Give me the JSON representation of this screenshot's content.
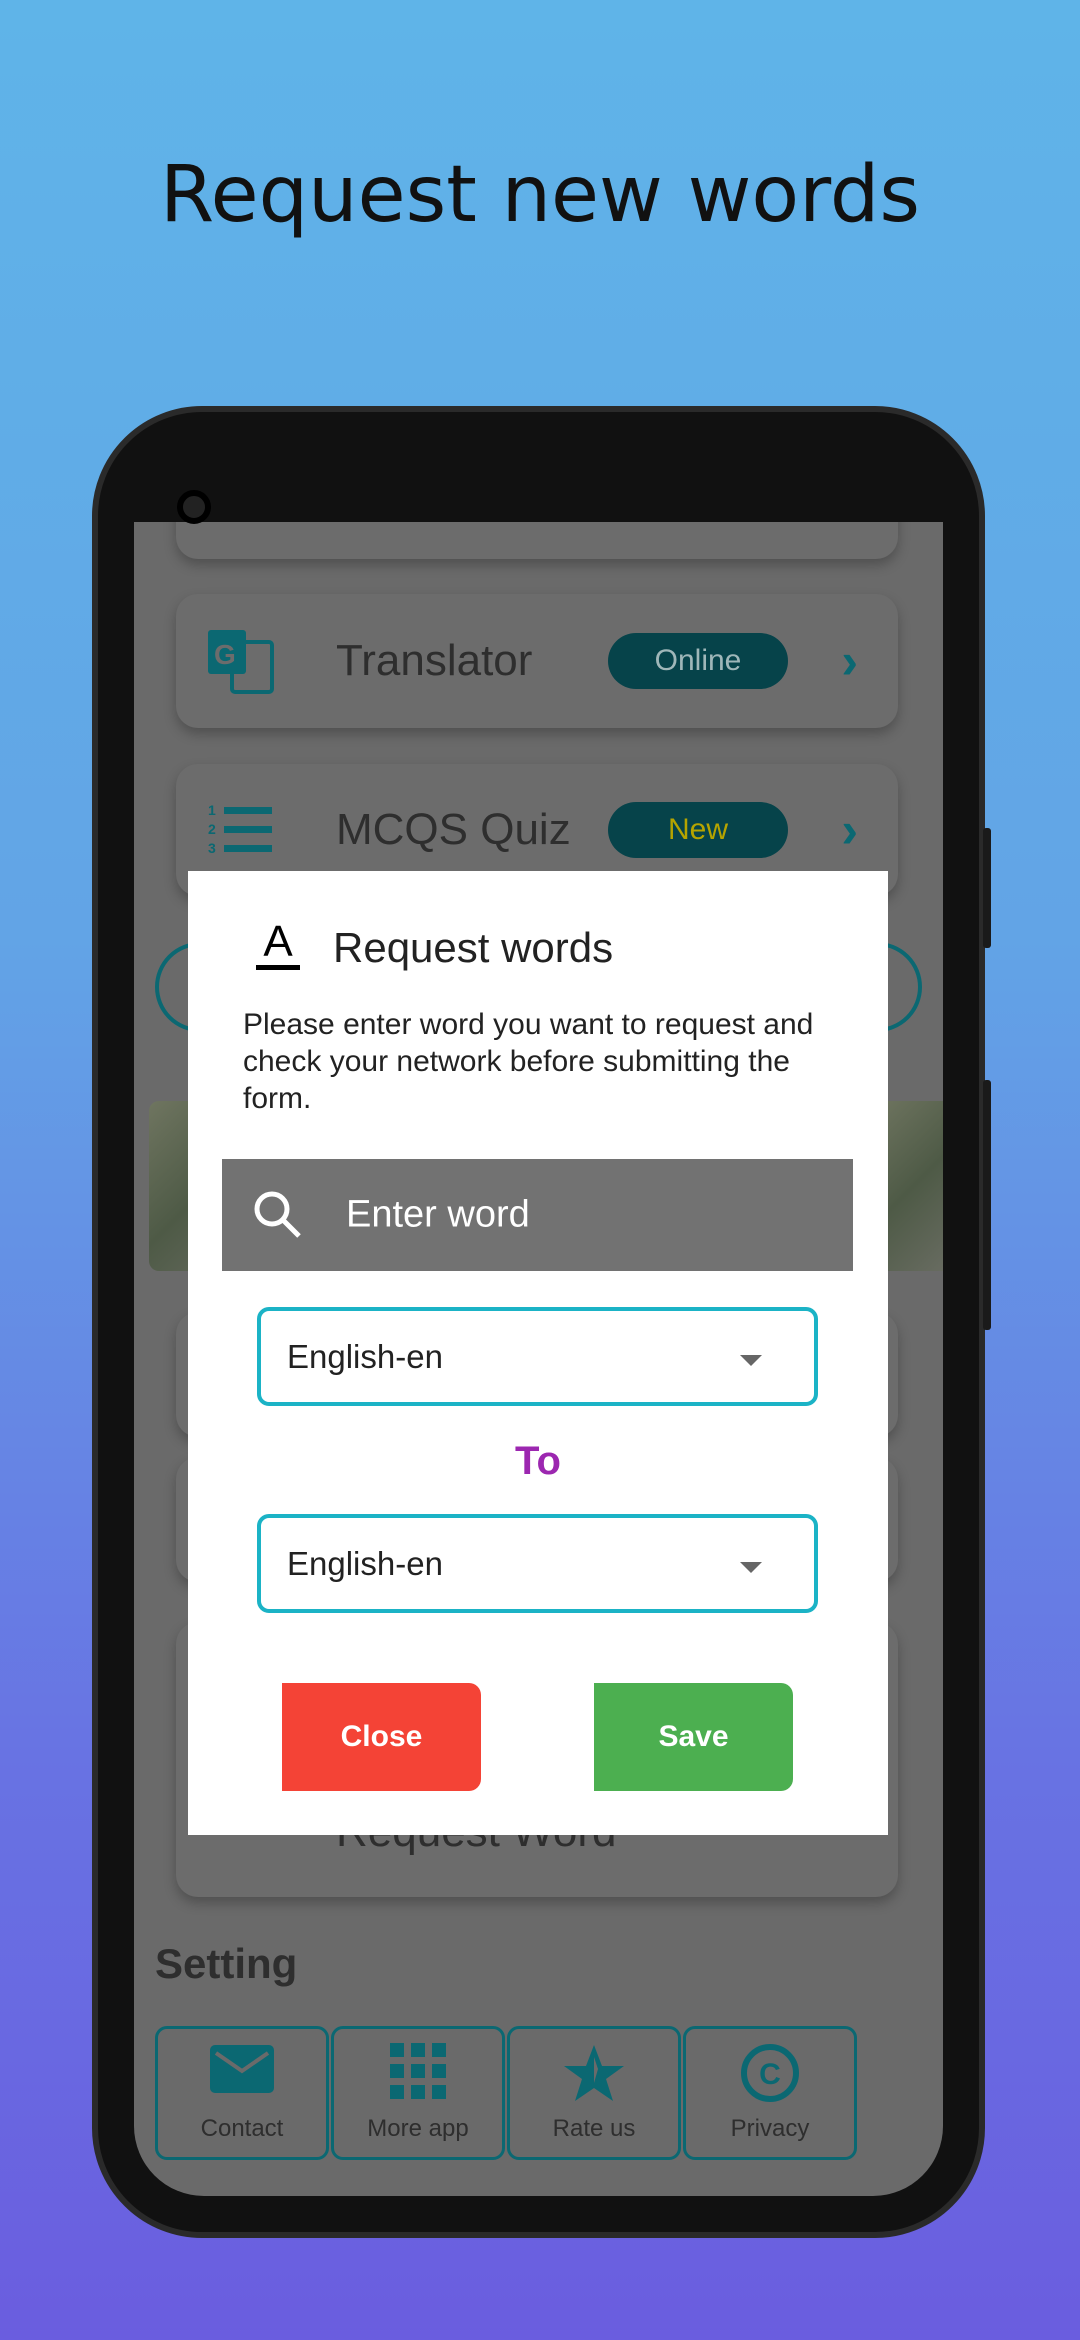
{
  "headline": "Request new words",
  "menu": {
    "translator": {
      "label": "Translator",
      "badge": "Online"
    },
    "quiz": {
      "label": "MCQS  Quiz",
      "badge": "New"
    },
    "request_word": {
      "label": "Request Word"
    }
  },
  "setting": {
    "title": "Setting",
    "items": [
      {
        "label": "Contact",
        "icon": "mail-icon"
      },
      {
        "label": "More app",
        "icon": "grid-icon"
      },
      {
        "label": "Rate us",
        "icon": "star-icon"
      },
      {
        "label": "Privacy",
        "icon": "copyright-icon"
      }
    ]
  },
  "dialog": {
    "title": "Request words",
    "description": "Please enter word you want to request and check your network before submitting the form.",
    "search_placeholder": "Enter word",
    "from_language": "English-en",
    "to_label": "To",
    "to_language": "English-en",
    "close_label": "Close",
    "save_label": "Save"
  },
  "colors": {
    "accent": "#0b6872",
    "close": "#f44336",
    "save": "#4caf50",
    "to": "#9c27b0",
    "select_border": "#1bb3c6",
    "quiz_badge_text": "#b5a400"
  }
}
